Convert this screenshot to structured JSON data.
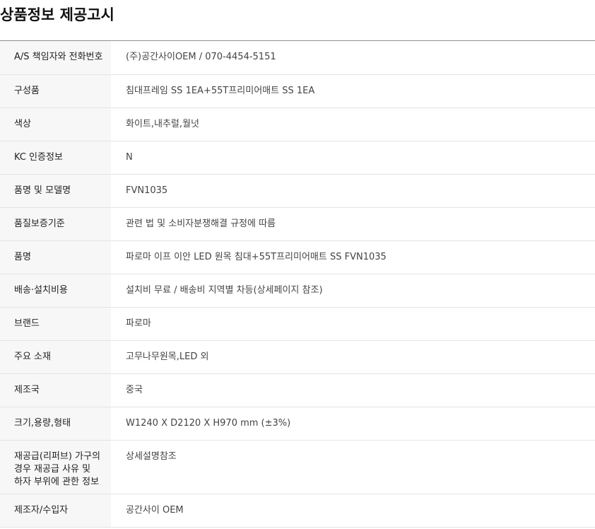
{
  "page": {
    "title": "상품정보 제공고시"
  },
  "rows": [
    {
      "label": "A/S 책임자와 전화번호",
      "value": "(주)공간사이OEM / 070-4454-5151"
    },
    {
      "label": "구성품",
      "value": "침대프레임 SS 1EA+55T프리미어매트 SS 1EA"
    },
    {
      "label": "색상",
      "value": "화이트,내추럴,월넛"
    },
    {
      "label": "KC 인증정보",
      "value": "N"
    },
    {
      "label": "품명 및 모델명",
      "value": "FVN1035"
    },
    {
      "label": "품질보증기준",
      "value": "관련 법 및 소비자분쟁해결 규정에 따름"
    },
    {
      "label": "품명",
      "value": "파로마 이프 이안 LED 원목 침대+55T프리미어매트 SS FVN1035"
    },
    {
      "label": "배송·설치비용",
      "value": "설치비 무료 / 배송비 지역별 차등(상세페이지 참조)"
    },
    {
      "label": "브랜드",
      "value": "파로마"
    },
    {
      "label": "주요 소재",
      "value": "고무나무원목,LED 외"
    },
    {
      "label": "제조국",
      "value": "중국"
    },
    {
      "label": "크기,용량,형태",
      "value": "W1240 X D2120 X H970 mm (±3%)"
    },
    {
      "label": "재공급(리퍼브) 가구의 경우 재공급 사유 및 하자 부위에 관한 정보",
      "value": "상세설명참조"
    },
    {
      "label": "제조자/수입자",
      "value": "공간사이 OEM"
    }
  ]
}
